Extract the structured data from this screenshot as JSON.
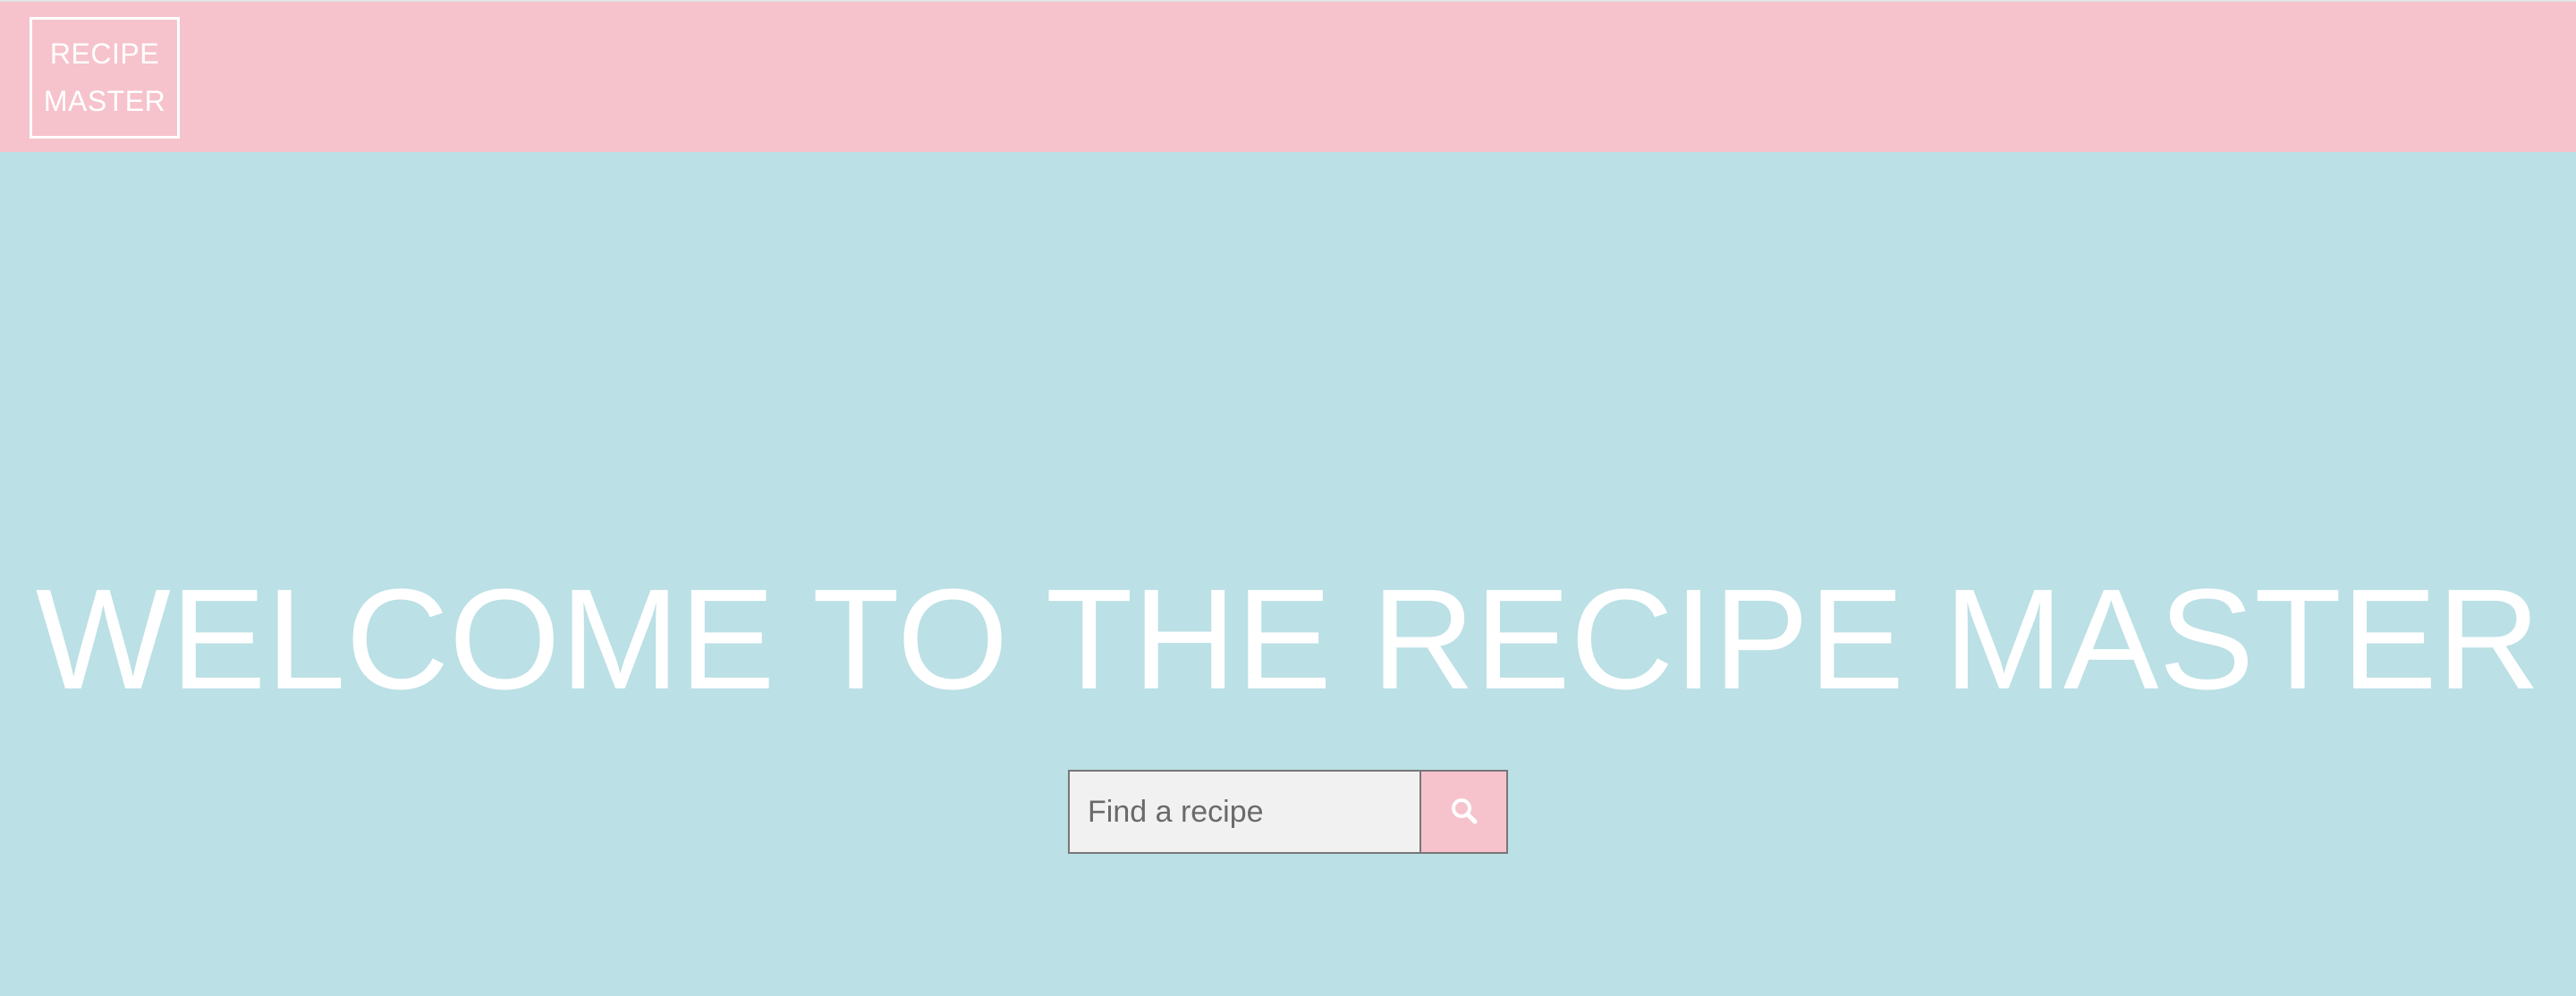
{
  "header": {
    "logo_line1": "RECIPE",
    "logo_line2": "MASTER"
  },
  "hero": {
    "title": "WELCOME TO THE RECIPE MASTER"
  },
  "search": {
    "placeholder": "Find a recipe",
    "value": "",
    "button_icon": "search-icon"
  },
  "colors": {
    "header_background": "#f6c3cc",
    "page_background": "#bbe0e5",
    "text": "#ffffff",
    "search_input_background": "#f1f1f1",
    "search_button_background": "#f6c3cc"
  }
}
